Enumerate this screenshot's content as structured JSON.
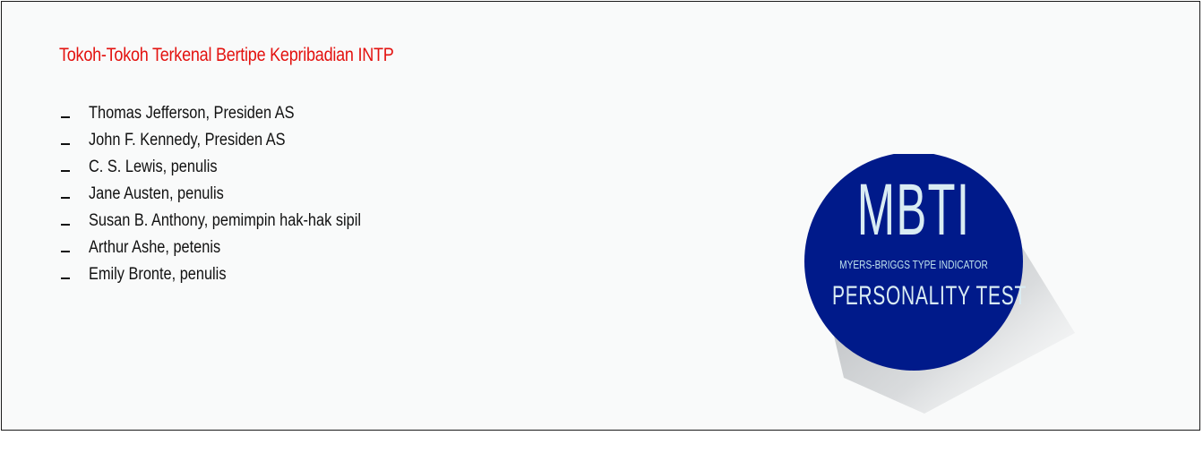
{
  "heading": {
    "text": "Tokoh-Tokoh Terkenal Bertipe Kepribadian INTP",
    "color": "#e3120f"
  },
  "people": [
    "Thomas Jefferson, Presiden AS",
    "John F. Kennedy, Presiden AS",
    "C. S. Lewis, penulis",
    "Jane Austen, penulis",
    "Susan B. Anthony, pemimpin hak-hak sipil",
    "Arthur Ashe, petenis",
    "Emily Bronte, penulis"
  ],
  "logo": {
    "main": "MBTI",
    "subtitle": "MYERS-BRIGGS TYPE INDICATOR",
    "bottom": "PERSONALITY TEST",
    "circle_color": "#001a8a"
  }
}
